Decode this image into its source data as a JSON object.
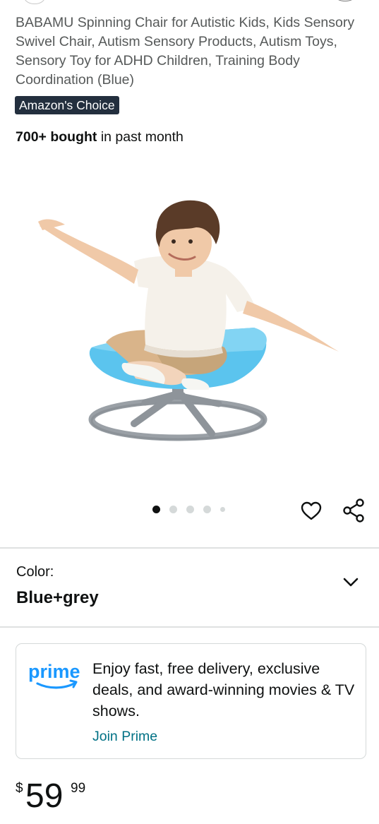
{
  "product": {
    "title": "BABAMU Spinning Chair for Autistic Kids, Kids Sensory Swivel Chair, Autism Sensory Products, Autism Toys, Sensory Toy for ADHD Children, Training Body Coordination (Blue)",
    "badge": "Amazon's Choice",
    "bought_strong": "700+ bought",
    "bought_rest": " in past month"
  },
  "gallery": {
    "image_icon": "product-image-child-on-spinning-chair",
    "dot_count": 5,
    "active_index": 0
  },
  "actions": {
    "wishlist_icon": "heart-icon",
    "share_icon": "share-icon"
  },
  "variant": {
    "label": "Color:",
    "value": "Blue+grey",
    "dropdown_icon": "chevron-down-icon"
  },
  "prime": {
    "logo_text": "prime",
    "message": "Enjoy fast, free delivery, exclusive deals, and award-winning movies & TV shows.",
    "link": "Join Prime"
  },
  "price": {
    "symbol": "$",
    "whole": "59",
    "fraction": "99"
  },
  "colors": {
    "badge_bg": "#232f3e",
    "link": "#007185",
    "prime_blue": "#1a98ff",
    "seat_blue": "#5bc4ee"
  }
}
